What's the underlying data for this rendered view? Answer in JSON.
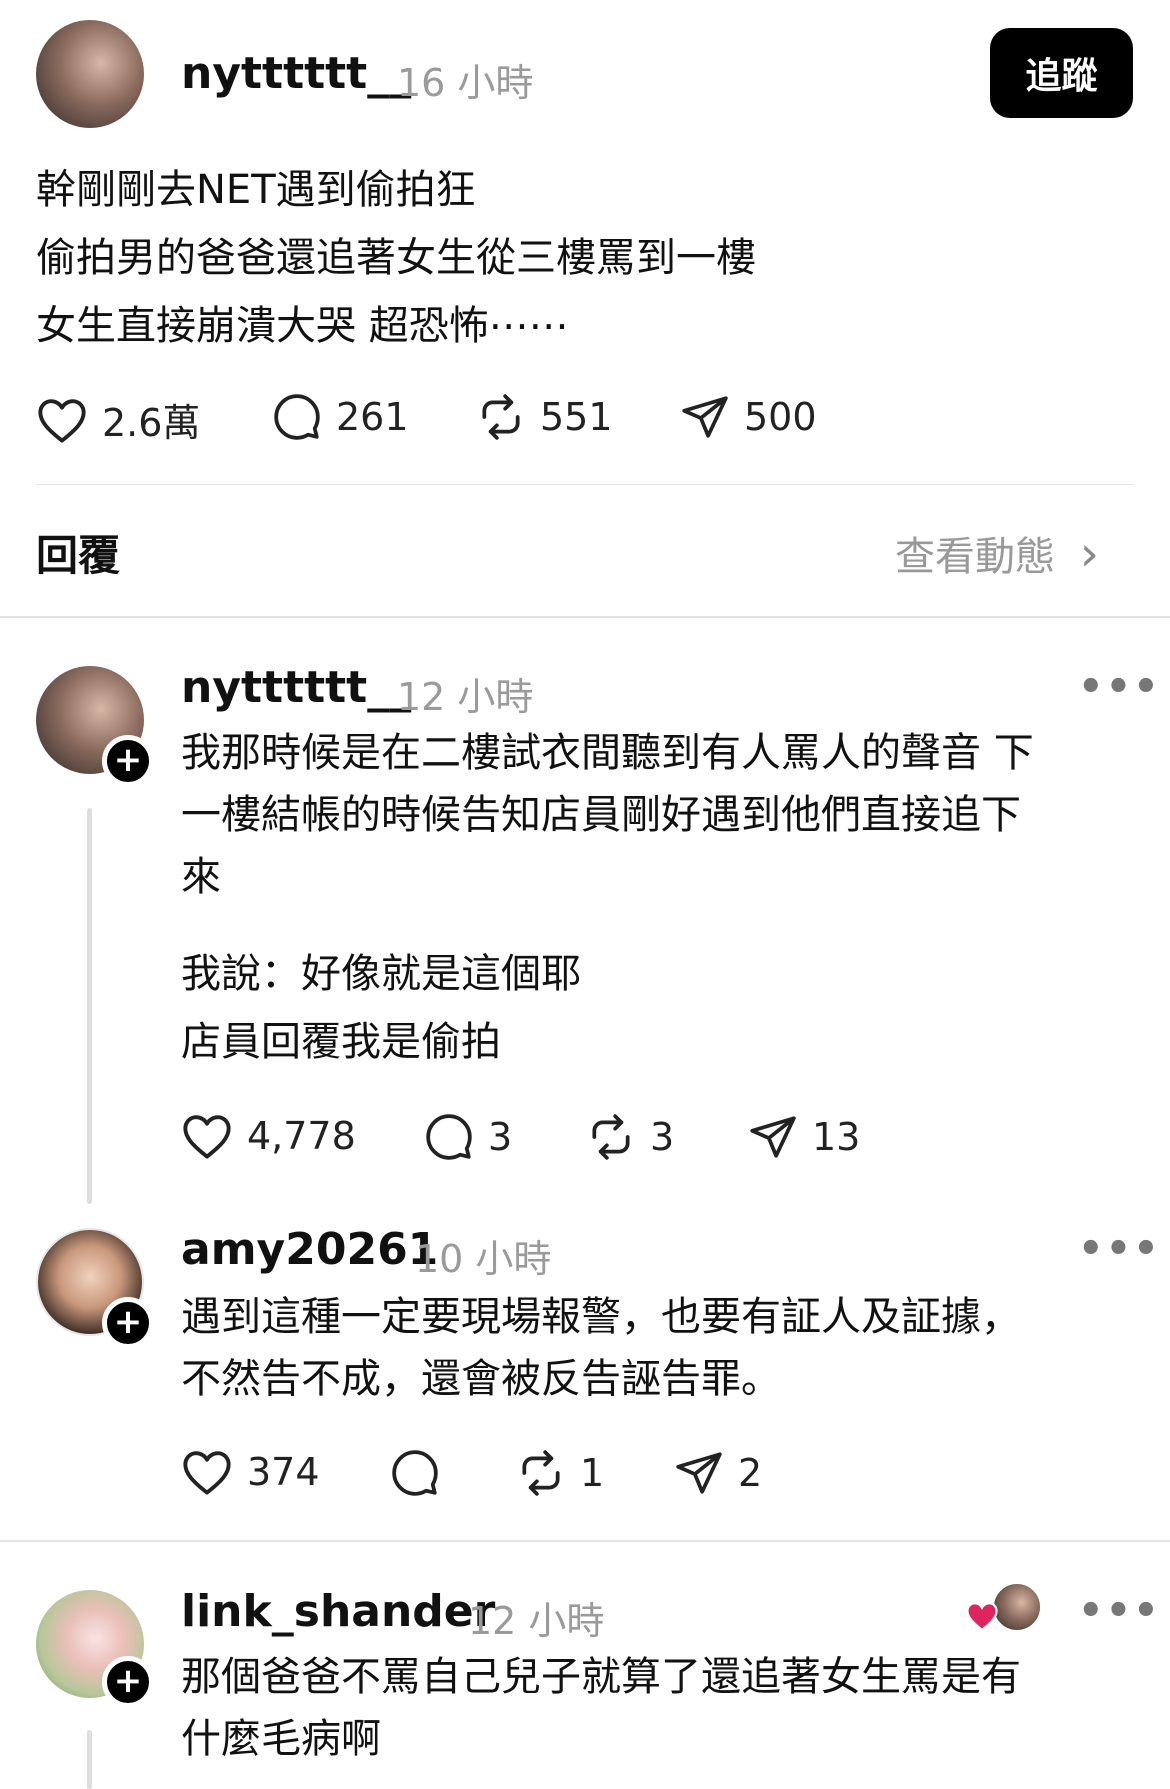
{
  "post": {
    "username": "nytttttt__",
    "time": "16 小時",
    "follow_label": "追蹤",
    "lines": [
      "幹剛剛去NET遇到偷拍狂",
      "偷拍男的爸爸還追著女生從三樓罵到一樓",
      "女生直接崩潰大哭 超恐怖⋯⋯"
    ],
    "likes": "2.6萬",
    "comments": "261",
    "reposts": "551",
    "shares": "500"
  },
  "replies_header": {
    "label": "回覆",
    "activity_label": "查看動態",
    "activity_chevron": "›"
  },
  "replies": [
    {
      "username": "nytttttt__",
      "time": "12 小時",
      "paragraph1": [
        "我那時候是在二樓試衣間聽到有人罵人的聲音 下",
        "一樓結帳的時候告知店員剛好遇到他們直接追下",
        "來"
      ],
      "paragraph2": [
        "我說：好像就是這個耶",
        "店員回覆我是偷拍"
      ],
      "likes": "4,778",
      "comments": "3",
      "reposts": "3",
      "shares": "13"
    },
    {
      "username": "amy20261",
      "time": "10 小時",
      "lines": [
        "遇到這種一定要現場報警，也要有証人及証據，",
        "不然告不成，還會被反告誣告罪。"
      ],
      "likes": "374",
      "reposts": "1",
      "shares": "2"
    },
    {
      "username": "link_shander",
      "time": "12 小時",
      "lines": [
        "那個爸爸不罵自己兒子就算了還追著女生罵是有",
        "什麼毛病啊"
      ]
    }
  ],
  "icons": {
    "like": "heart-icon",
    "comment": "comment-icon",
    "repost": "repost-icon",
    "share": "send-icon",
    "more": "more-dots-icon",
    "follow": "plus-icon",
    "liked_by_author": "heart-filled-icon"
  },
  "colors": {
    "accent": "#000000",
    "muted_text": "#9a9a9a",
    "liked_heart": "#e0245e"
  }
}
